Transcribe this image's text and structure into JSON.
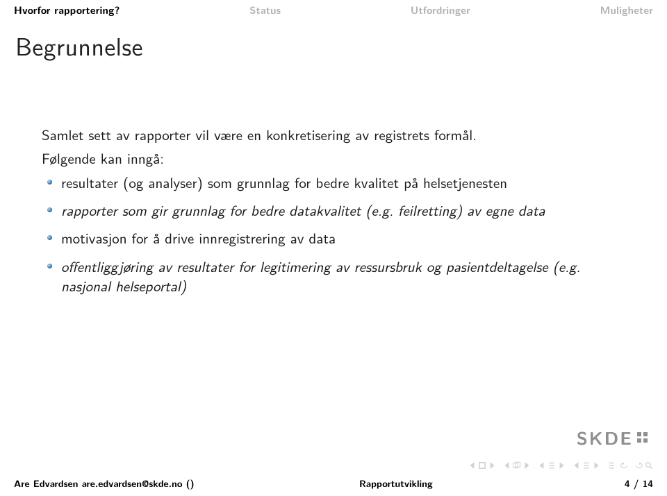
{
  "nav": {
    "items": [
      {
        "label": "Hvorfor rapportering?",
        "active": true
      },
      {
        "label": "Status",
        "active": false
      },
      {
        "label": "Utfordringer",
        "active": false
      },
      {
        "label": "Muligheter",
        "active": false
      }
    ]
  },
  "title": "Begrunnelse",
  "body": {
    "intro1": "Samlet sett av rapporter vil være en konkretisering av registrets formål.",
    "intro2": "Følgende kan inngå:",
    "bullets": [
      "resultater (og analyser) som grunnlag for bedre kvalitet på helsetjenesten",
      "rapporter som gir grunnlag for bedre datakvalitet (e.g. feilretting) av egne data",
      "motivasjon for å drive innregistrering av data",
      "offentliggjøring av resultater for legitimering av ressursbruk og pasientdeltagelse (e.g. nasjonal helseportal)"
    ]
  },
  "logo": {
    "text": "SKDE"
  },
  "footer": {
    "author": "Are Edvardsen are.edvardsen@skde.no ()",
    "center": "Rapportutvikling",
    "page": "4 / 14"
  }
}
